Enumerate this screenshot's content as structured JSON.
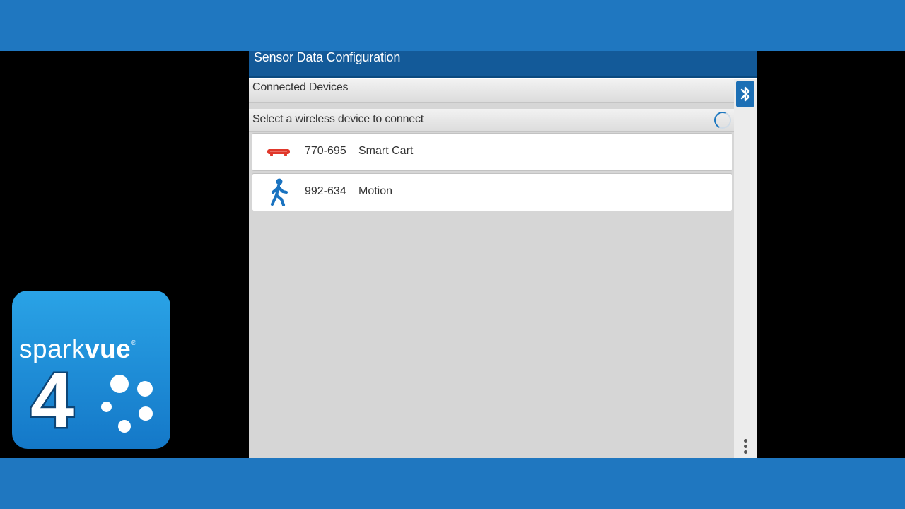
{
  "colors": {
    "band_blue": "#1f77c0",
    "header_blue": "#135a99",
    "bluetooth_blue": "#1c6fb5",
    "cart_red": "#e0382b",
    "motion_blue": "#1a73c0",
    "logo_blue_top": "#2aa3e6",
    "logo_blue_bottom": "#1478c8"
  },
  "app": {
    "title": "Sensor Data Configuration",
    "connected_section": "Connected Devices",
    "select_section": "Select a wireless device to connect",
    "bluetooth_icon": "bluetooth-icon",
    "spinner": "loading-spinner",
    "devices": [
      {
        "id": "770-695",
        "name": "Smart Cart",
        "icon": "smart-cart-icon"
      },
      {
        "id": "992-634",
        "name": "Motion",
        "icon": "walking-person-icon"
      }
    ],
    "menu_icon": "overflow-menu-icon"
  },
  "logo": {
    "word_light": "spark",
    "word_bold": "vue",
    "registered": "®",
    "version": "4"
  }
}
